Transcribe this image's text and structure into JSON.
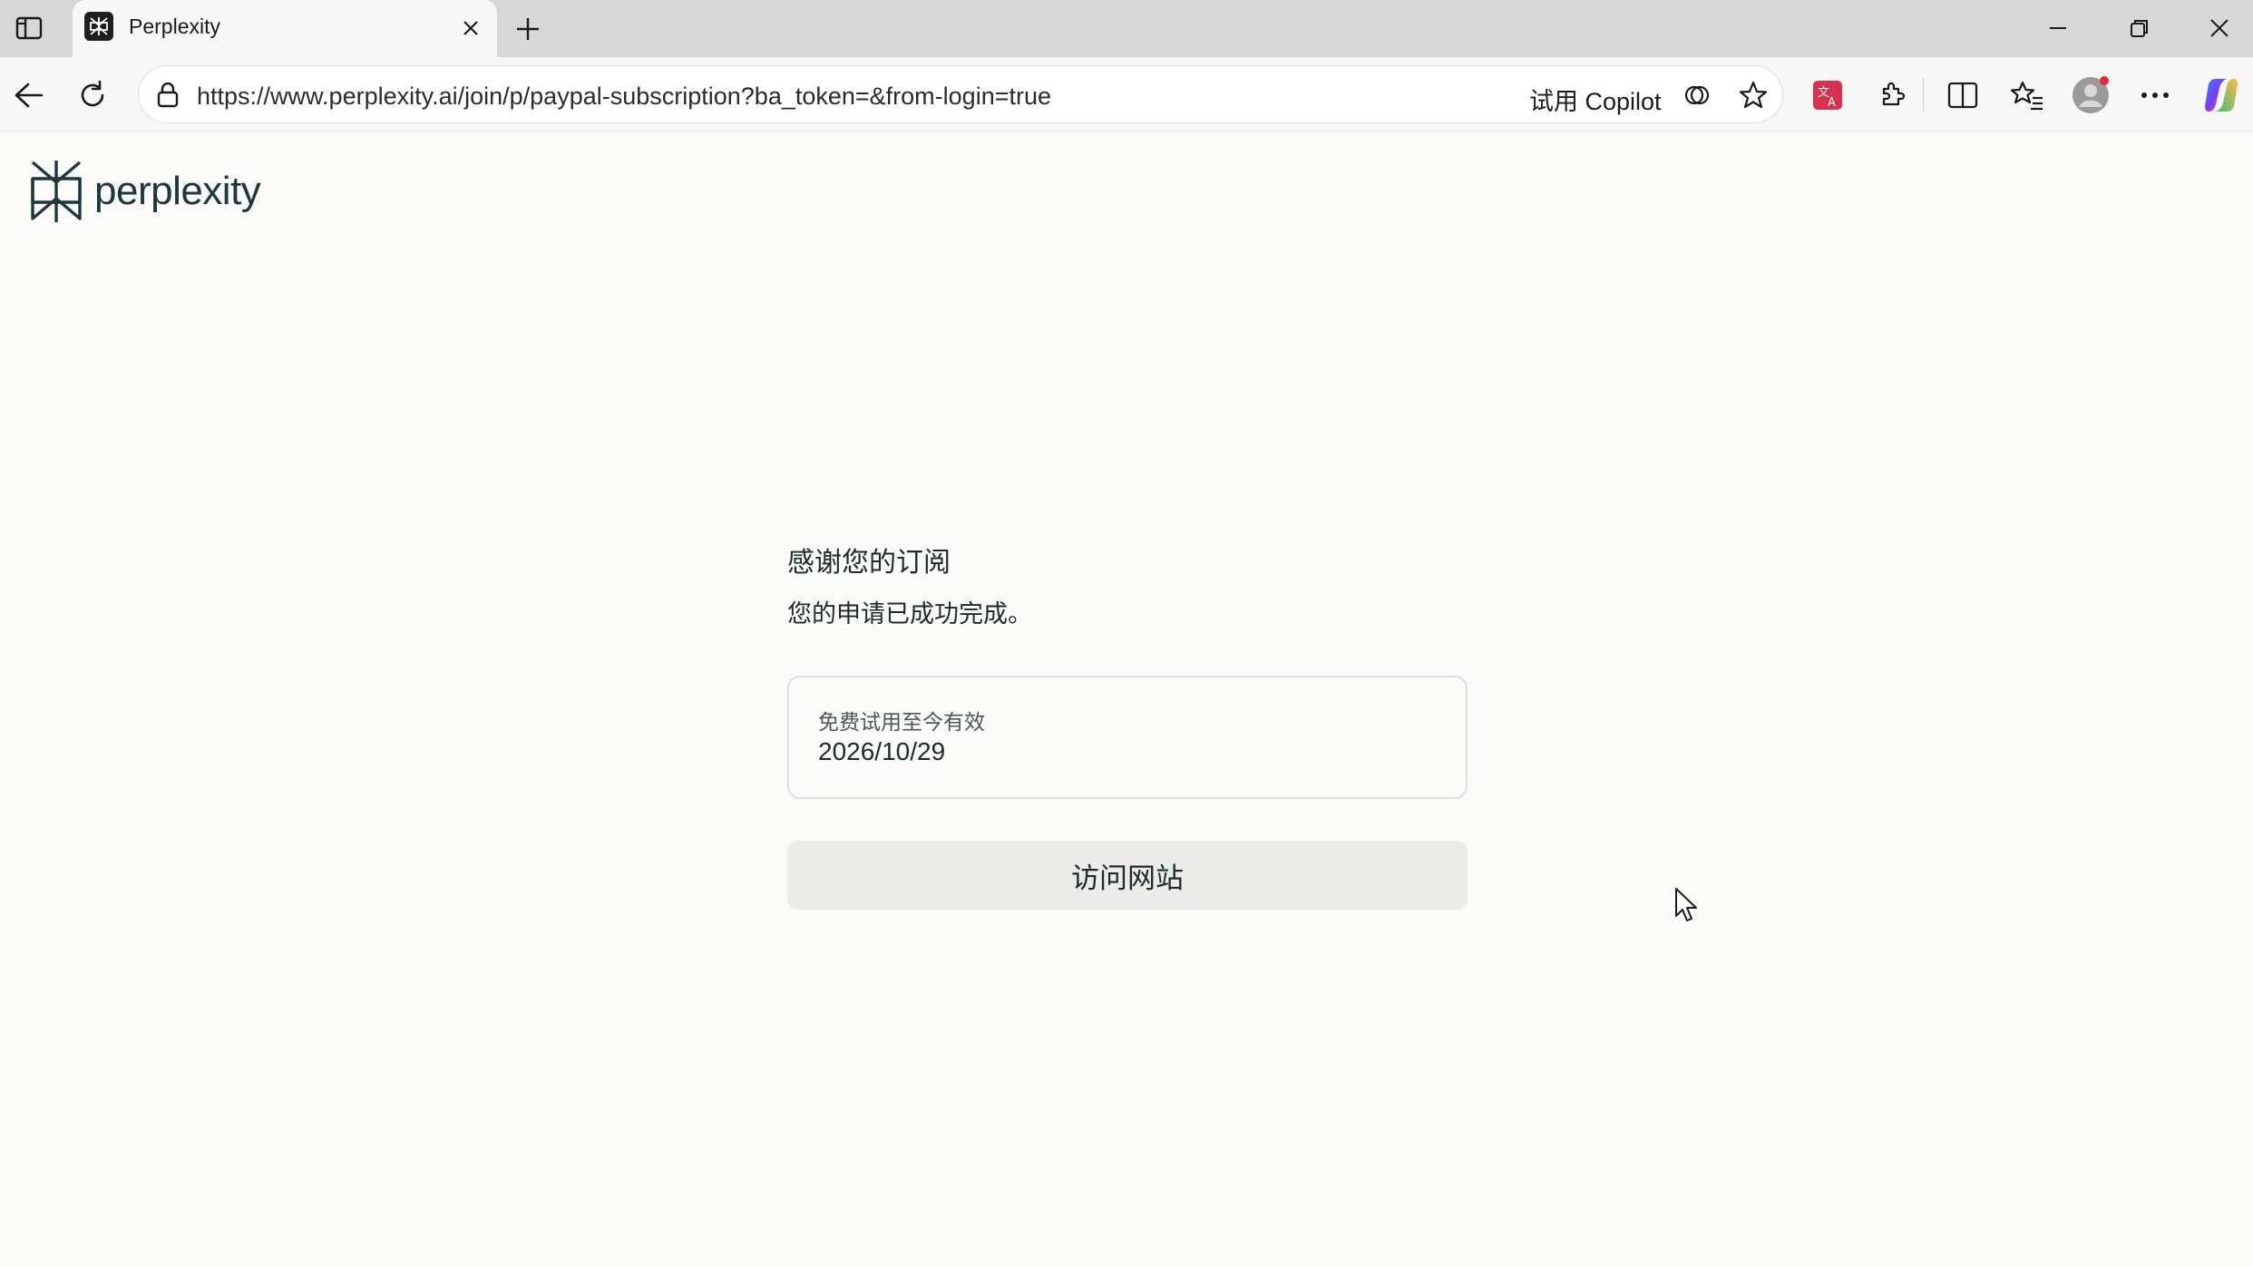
{
  "browser": {
    "tab": {
      "title": "Perplexity",
      "favicon": "perplexity-logo-icon"
    },
    "new_tab_icon": "plus-icon",
    "window_controls": [
      "minimize-icon",
      "restore-icon",
      "close-icon"
    ],
    "address_bar": {
      "url": "https://www.perplexity.ai/join/p/paypal-subscription?ba_token=&from-login=true",
      "copilot_label": "试用 Copilot"
    },
    "toolbar_icons": [
      "back-icon",
      "refresh-icon",
      "site-info-icon",
      "copilot-icon",
      "favorite-star-icon",
      "translate-icon",
      "extensions-icon",
      "split-screen-icon",
      "favorites-icon",
      "profile-avatar",
      "more-options-icon",
      "copilot-sidebar-icon"
    ]
  },
  "page": {
    "logo_text": "perplexity",
    "heading": "感谢您的订阅",
    "subheading": "您的申请已成功完成。",
    "trial": {
      "label": "免费试用至今有效",
      "date": "2026/10/29"
    },
    "visit_button": "访问网站"
  },
  "colors": {
    "page_background": "#fafaf9",
    "logo": "#20373d",
    "button_background": "#ebebea",
    "card_border": "#dedede"
  }
}
